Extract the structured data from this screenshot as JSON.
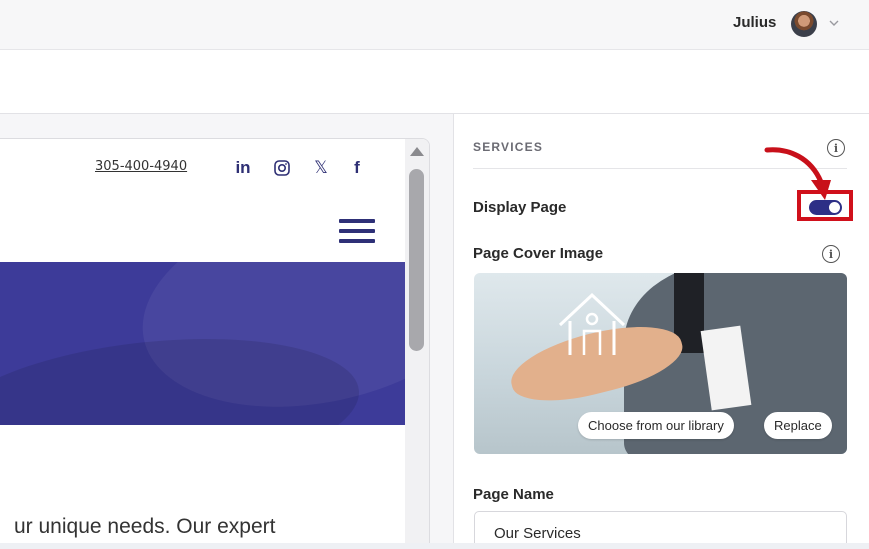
{
  "header": {
    "user_name": "Julius"
  },
  "preview": {
    "phone": "305-400-4940",
    "social_icons": [
      "linkedin-icon",
      "instagram-icon",
      "x-icon",
      "facebook-icon"
    ],
    "social_labels": {
      "linkedin": "in",
      "x": "𝕏",
      "facebook": "f"
    },
    "body_text": "ur unique needs. Our expert"
  },
  "sidebar": {
    "section_title": "SERVICES",
    "display_page_label": "Display Page",
    "display_page_on": true,
    "cover_label": "Page Cover Image",
    "choose_library_label": "Choose from our library",
    "replace_label": "Replace",
    "page_name_label": "Page Name",
    "page_name_value": "Our Services"
  },
  "colors": {
    "brand": "#2d2f86",
    "hero": "#3d3b99",
    "highlight": "#d0101b"
  }
}
